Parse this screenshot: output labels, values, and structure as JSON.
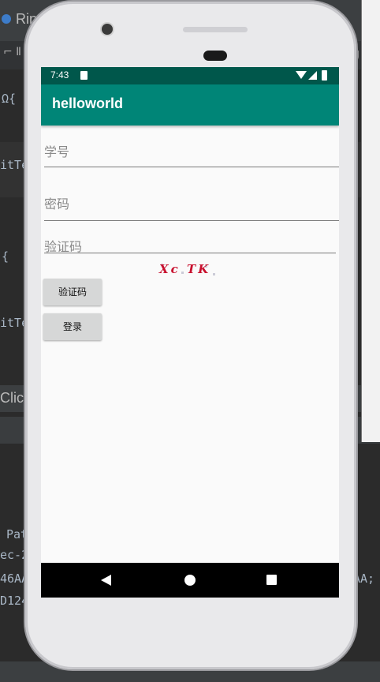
{
  "ide": {
    "tab_label": "Ring",
    "click_label": "Click",
    "code_fragments": [
      "Ω{",
      "itTe",
      "{",
      "itTe",
      "Pat",
      "ec-2",
      "46AA",
      "AA;",
      "D124"
    ]
  },
  "status_bar": {
    "time": "7:43",
    "icons": [
      "sd-card-icon",
      "wifi-icon",
      "signal-icon",
      "battery-icon"
    ]
  },
  "app_bar": {
    "title": "helloworld"
  },
  "form": {
    "student_id_hint": "学号",
    "password_hint": "密码",
    "captcha_hint": "验证码",
    "captcha_image_text": "Xc TK",
    "captcha_button_label": "验证码",
    "login_button_label": "登录"
  },
  "nav_bar": {
    "icons": [
      "back-icon",
      "home-icon",
      "recents-icon"
    ]
  },
  "colors": {
    "status_bar": "#00574b",
    "app_bar": "#008577",
    "captcha_text": "#c8102e",
    "button": "#d6d7d7"
  }
}
